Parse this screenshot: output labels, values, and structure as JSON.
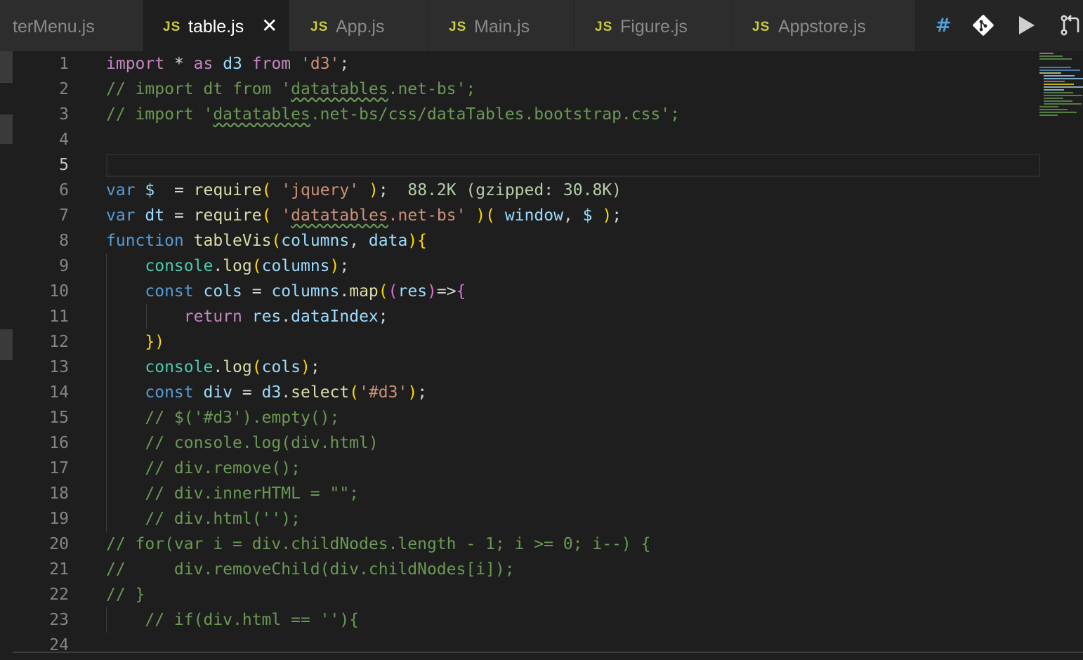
{
  "tabs": [
    {
      "label": "terMenu.js",
      "badge": ""
    },
    {
      "label": "table.js",
      "badge": "JS",
      "active": true,
      "close": "✕"
    },
    {
      "label": "App.js",
      "badge": "JS"
    },
    {
      "label": "Main.js",
      "badge": "JS"
    },
    {
      "label": "Figure.js",
      "badge": "JS"
    },
    {
      "label": "Appstore.js",
      "badge": "JS"
    }
  ],
  "actions": {
    "hash": "#"
  },
  "editor": {
    "current_line": 5,
    "lines": [
      {
        "n": "1",
        "text": "import * as d3 from 'd3';"
      },
      {
        "n": "2",
        "text": "// import dt from 'datatables.net-bs';"
      },
      {
        "n": "3",
        "text": "// import 'datatables.net-bs/css/dataTables.bootstrap.css';"
      },
      {
        "n": "4",
        "text": ""
      },
      {
        "n": "5",
        "text": ""
      },
      {
        "n": "6",
        "text": "var $  = require( 'jquery' );  88.2K (gzipped: 30.8K)"
      },
      {
        "n": "7",
        "text": "var dt = require( 'datatables.net-bs' )( window, $ );"
      },
      {
        "n": "8",
        "text": "function tableVis(columns, data){"
      },
      {
        "n": "9",
        "text": "    console.log(columns);"
      },
      {
        "n": "10",
        "text": "    const cols = columns.map((res)=>{"
      },
      {
        "n": "11",
        "text": "        return res.dataIndex;"
      },
      {
        "n": "12",
        "text": "    })"
      },
      {
        "n": "13",
        "text": "    console.log(cols);"
      },
      {
        "n": "14",
        "text": "    const div = d3.select('#d3');"
      },
      {
        "n": "15",
        "text": "    // $('#d3').empty();"
      },
      {
        "n": "16",
        "text": "    // console.log(div.html)"
      },
      {
        "n": "17",
        "text": "    // div.remove();"
      },
      {
        "n": "18",
        "text": "    // div.innerHTML = \"\";"
      },
      {
        "n": "19",
        "text": "    // div.html('');"
      },
      {
        "n": "20",
        "text": "// for(var i = div.childNodes.length - 1; i >= 0; i--) {"
      },
      {
        "n": "21",
        "text": "//     div.removeChild(div.childNodes[i]);"
      },
      {
        "n": "22",
        "text": "// }"
      },
      {
        "n": "23",
        "text": "    // if(div.html == ''){"
      },
      {
        "n": "24",
        "text": ""
      }
    ]
  },
  "colors": {
    "background": "#1e1e1e",
    "tabbar": "#252526",
    "js_badge": "#cbcb41",
    "comment": "#6a9955",
    "keyword": "#569cd6",
    "string": "#ce9178"
  }
}
